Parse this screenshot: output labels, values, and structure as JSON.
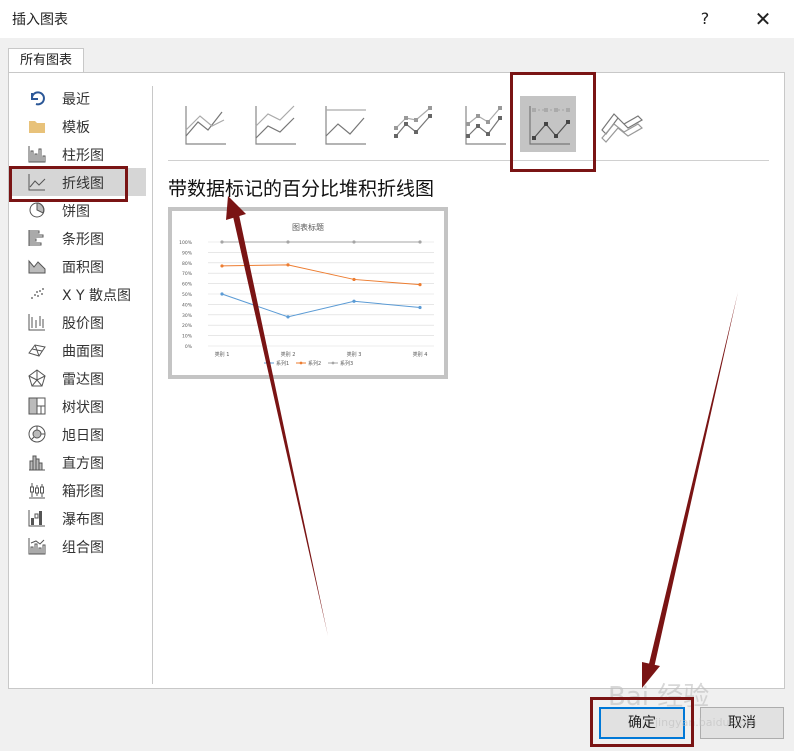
{
  "dialog": {
    "title": "插入图表",
    "help_label": "?",
    "close_label": "✕",
    "tab_label": "所有图表"
  },
  "sidebar": {
    "items": [
      {
        "label": "最近",
        "icon": "recent-icon"
      },
      {
        "label": "模板",
        "icon": "template-folder-icon"
      },
      {
        "label": "柱形图",
        "icon": "column-chart-icon"
      },
      {
        "label": "折线图",
        "icon": "line-chart-icon",
        "selected": true
      },
      {
        "label": "饼图",
        "icon": "pie-chart-icon"
      },
      {
        "label": "条形图",
        "icon": "bar-chart-icon"
      },
      {
        "label": "面积图",
        "icon": "area-chart-icon"
      },
      {
        "label": "X Y 散点图",
        "icon": "scatter-chart-icon"
      },
      {
        "label": "股价图",
        "icon": "stock-chart-icon"
      },
      {
        "label": "曲面图",
        "icon": "surface-chart-icon"
      },
      {
        "label": "雷达图",
        "icon": "radar-chart-icon"
      },
      {
        "label": "树状图",
        "icon": "treemap-chart-icon"
      },
      {
        "label": "旭日图",
        "icon": "sunburst-chart-icon"
      },
      {
        "label": "直方图",
        "icon": "histogram-chart-icon"
      },
      {
        "label": "箱形图",
        "icon": "box-whisker-chart-icon"
      },
      {
        "label": "瀑布图",
        "icon": "waterfall-chart-icon"
      },
      {
        "label": "组合图",
        "icon": "combo-chart-icon"
      }
    ]
  },
  "subtypes": [
    {
      "icon": "line-icon"
    },
    {
      "icon": "stacked-line-icon"
    },
    {
      "icon": "percent-stacked-line-icon"
    },
    {
      "icon": "line-with-markers-icon"
    },
    {
      "icon": "stacked-line-with-markers-icon"
    },
    {
      "icon": "percent-stacked-line-with-markers-icon",
      "selected": true
    },
    {
      "icon": "3d-line-icon"
    }
  ],
  "selected_type_title": "带数据标记的百分比堆积折线图",
  "preview": {
    "title": "图表标题",
    "y_ticks": [
      "100%",
      "90%",
      "80%",
      "70%",
      "60%",
      "50%",
      "40%",
      "30%",
      "20%",
      "10%",
      "0%"
    ],
    "categories": [
      "类别 1",
      "类别 2",
      "类别 3",
      "类别 4"
    ],
    "series": [
      {
        "name": "系列1",
        "color": "#5b9bd5",
        "values": [
          50,
          28,
          43,
          37
        ]
      },
      {
        "name": "系列2",
        "color": "#ed7d31",
        "values": [
          77,
          78,
          64,
          59
        ]
      },
      {
        "name": "系列3",
        "color": "#a5a5a5",
        "values": [
          100,
          100,
          100,
          100
        ]
      }
    ]
  },
  "buttons": {
    "ok_label": "确定",
    "cancel_label": "取消"
  },
  "watermark": {
    "text": "Bai 经验",
    "sub": "jingyan.baidu.com"
  },
  "colors": {
    "highlight": "#7a1414",
    "selected_bg": "#d6d6d6",
    "ok_border": "#0078d7"
  }
}
